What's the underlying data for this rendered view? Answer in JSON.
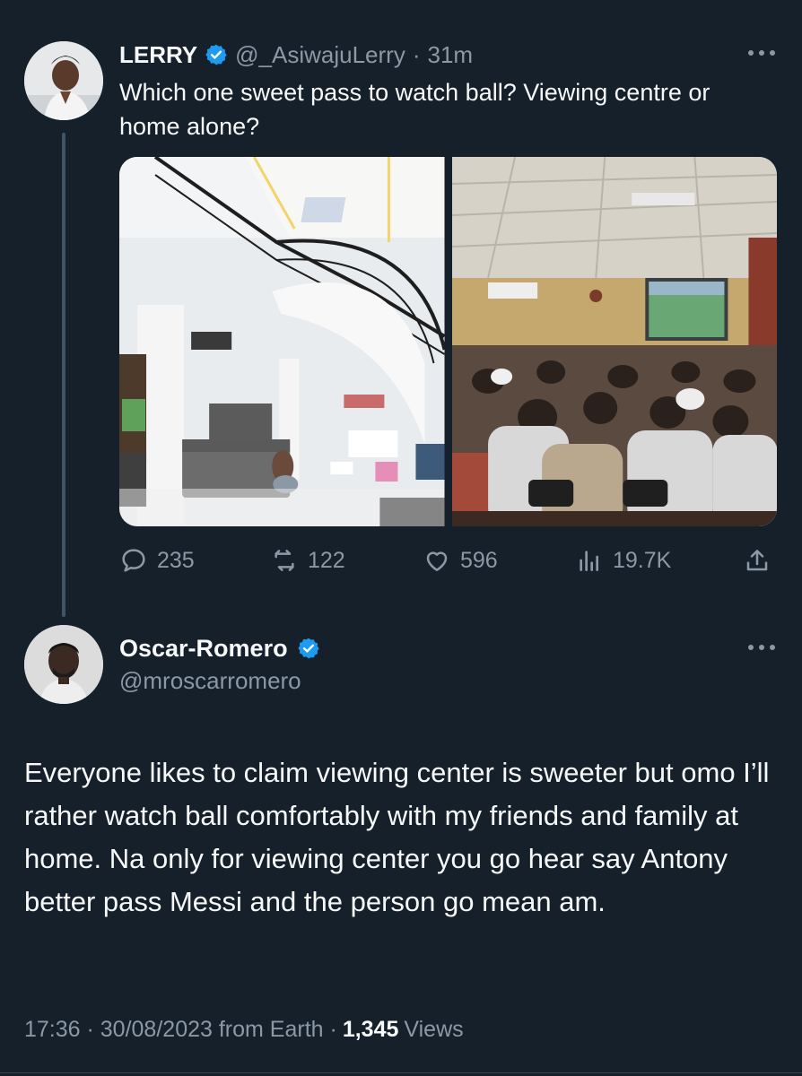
{
  "tweet1": {
    "author_name": "LERRY",
    "handle": "@_AsiwajuLerry",
    "separator": "·",
    "time_ago": "31m",
    "text": "Which one sweet pass to watch ball? Viewing centre or home alone?",
    "stats": {
      "replies": "235",
      "retweets": "122",
      "likes": "596",
      "views": "19.7K"
    },
    "icons": [
      "reply-icon",
      "retweet-icon",
      "like-icon",
      "views-icon",
      "share-icon"
    ]
  },
  "tweet2": {
    "author_name": "Oscar-Romero",
    "handle": "@mroscarromero",
    "text": "Everyone likes to claim viewing center is sweeter but omo I’ll rather watch ball comfortably with my friends and family at home. Na only for viewing center you go hear say Antony better pass Messi and the person go mean am.",
    "timestamp": "17:36 · 30/08/2023 from Earth ·",
    "views_count": "1,345",
    "views_label": "Views"
  },
  "colors": {
    "background": "#15202b",
    "text_primary": "#f7f9f9",
    "text_secondary": "#8b98a5",
    "verified": "#1d9bf0",
    "thread_line": "#425364"
  }
}
